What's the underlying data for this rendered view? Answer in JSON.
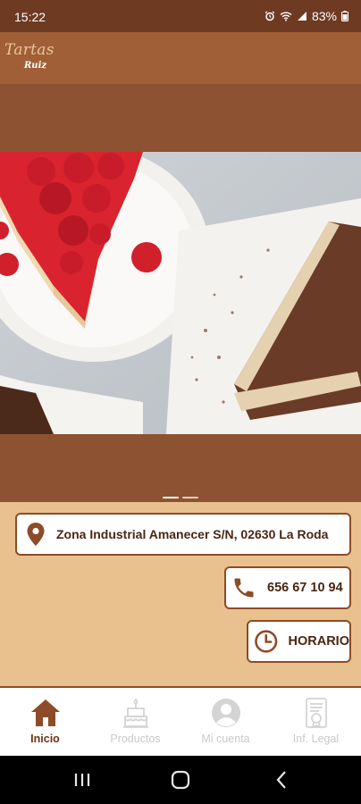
{
  "status_bar": {
    "time": "15:22",
    "battery": "83%",
    "icons": [
      "alarm-icon",
      "wifi-icon",
      "signal-icon",
      "battery-icon"
    ]
  },
  "app_bar": {
    "logo_main": "Tartas",
    "logo_sub": "Ruiz"
  },
  "carousel": {
    "page_count": 2,
    "active_page": 0
  },
  "info": {
    "address": "Zona Industrial Amanecer S/N, 02630 La Roda",
    "phone": "656 67 10 94",
    "hours_label": "HORARIO"
  },
  "bottom_nav": {
    "items": [
      {
        "label": "Inicio",
        "icon": "home-icon",
        "active": true
      },
      {
        "label": "Productos",
        "icon": "cake-icon",
        "active": false
      },
      {
        "label": "Mi cuenta",
        "icon": "account-icon",
        "active": false
      },
      {
        "label": "Inf. Legal",
        "icon": "legal-document-icon",
        "active": false
      }
    ]
  },
  "colors": {
    "status_bar": "#6e3a22",
    "app_bar": "#a15f38",
    "hero_band": "#8d5231",
    "background": "#e8c18f",
    "accent": "#8e4b27",
    "text_dark": "#4a2612"
  }
}
